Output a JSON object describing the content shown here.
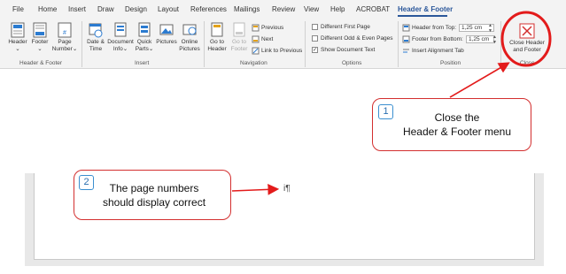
{
  "tabs": [
    "File",
    "Home",
    "Insert",
    "Draw",
    "Design",
    "Layout",
    "References",
    "Mailings",
    "Review",
    "View",
    "Help",
    "ACROBAT",
    "Header & Footer"
  ],
  "active_tab": "Header & Footer",
  "groups": {
    "header_footer": {
      "label": "Header & Footer",
      "header_label": "Header",
      "footer_label": "Footer",
      "page_number_label_1": "Page",
      "page_number_label_2": "Number"
    },
    "insert": {
      "label": "Insert",
      "date_time_1": "Date &",
      "date_time_2": "Time",
      "document_info_1": "Document",
      "document_info_2": "Info",
      "quick_parts_1": "Quick",
      "quick_parts_2": "Parts",
      "pictures": "Pictures",
      "online_pictures_1": "Online",
      "online_pictures_2": "Pictures"
    },
    "navigation": {
      "label": "Navigation",
      "go_to_header_1": "Go to",
      "go_to_header_2": "Header",
      "go_to_footer_1": "Go to",
      "go_to_footer_2": "Footer",
      "previous": "Previous",
      "next": "Next",
      "link_to_previous": "Link to Previous"
    },
    "options": {
      "label": "Options",
      "different_first_page": "Different First Page",
      "different_odd_even": "Different Odd & Even Pages",
      "show_document_text": "Show Document Text",
      "show_document_text_checked": true
    },
    "position": {
      "label": "Position",
      "header_from_top": "Header from Top:",
      "header_from_top_value": "1,25 cm",
      "footer_from_bottom": "Footer from Bottom:",
      "footer_from_bottom_value": "1,25 cm",
      "insert_alignment_tab": "Insert Alignment Tab"
    },
    "close": {
      "label": "Close",
      "close_button_1": "Close Header",
      "close_button_2": "and Footer"
    }
  },
  "document": {
    "paragraph_mark": "i¶"
  },
  "callouts": {
    "close": {
      "number": "1",
      "line1": "Close the",
      "line2": "Header & Footer menu"
    },
    "page_numbers": {
      "number": "2",
      "line1": "The page numbers",
      "line2": "should display correct"
    }
  },
  "colors": {
    "accent": "#2b579a",
    "callout_border": "#d32f2f",
    "highlight_ring": "#e31b1b",
    "number_badge": "#3b8fd0"
  }
}
